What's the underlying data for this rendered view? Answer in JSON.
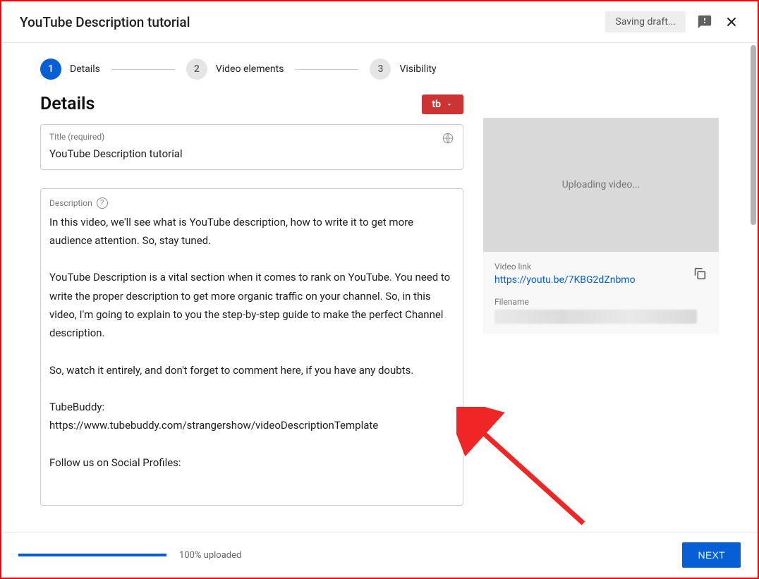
{
  "header": {
    "title": "YouTube Description tutorial",
    "saving_label": "Saving draft..."
  },
  "stepper": {
    "items": [
      {
        "num": "1",
        "label": "Details",
        "active": true
      },
      {
        "num": "2",
        "label": "Video elements",
        "active": false
      },
      {
        "num": "3",
        "label": "Visibility",
        "active": false
      }
    ]
  },
  "details": {
    "section_title": "Details",
    "tb_label": "tb",
    "title_field": {
      "label": "Title (required)",
      "value": "YouTube Description tutorial"
    },
    "description_field": {
      "label": "Description",
      "value": "In this video, we'll see what is YouTube description, how to write it to get more audience attention. So, stay tuned.\n\nYouTube Description is a vital section when it comes to rank on YouTube. You need to write the proper description to get more organic traffic on your channel. So, in this video, I'm going to explain to you the step-by-step guide to make the perfect Channel description.\n\nSo, watch it entirely, and don't forget to comment here, if you have any doubts.\n\nTubeBuddy:\nhttps://www.tubebuddy.com/strangershow/videoDescriptionTemplate\n\nFollow us on Social Profiles:"
    }
  },
  "preview": {
    "status": "Uploading video...",
    "link_label": "Video link",
    "link_value": "https://youtu.be/7KBG2dZnbmo",
    "filename_label": "Filename"
  },
  "footer": {
    "progress_text": "100% uploaded",
    "next_label": "NEXT"
  }
}
